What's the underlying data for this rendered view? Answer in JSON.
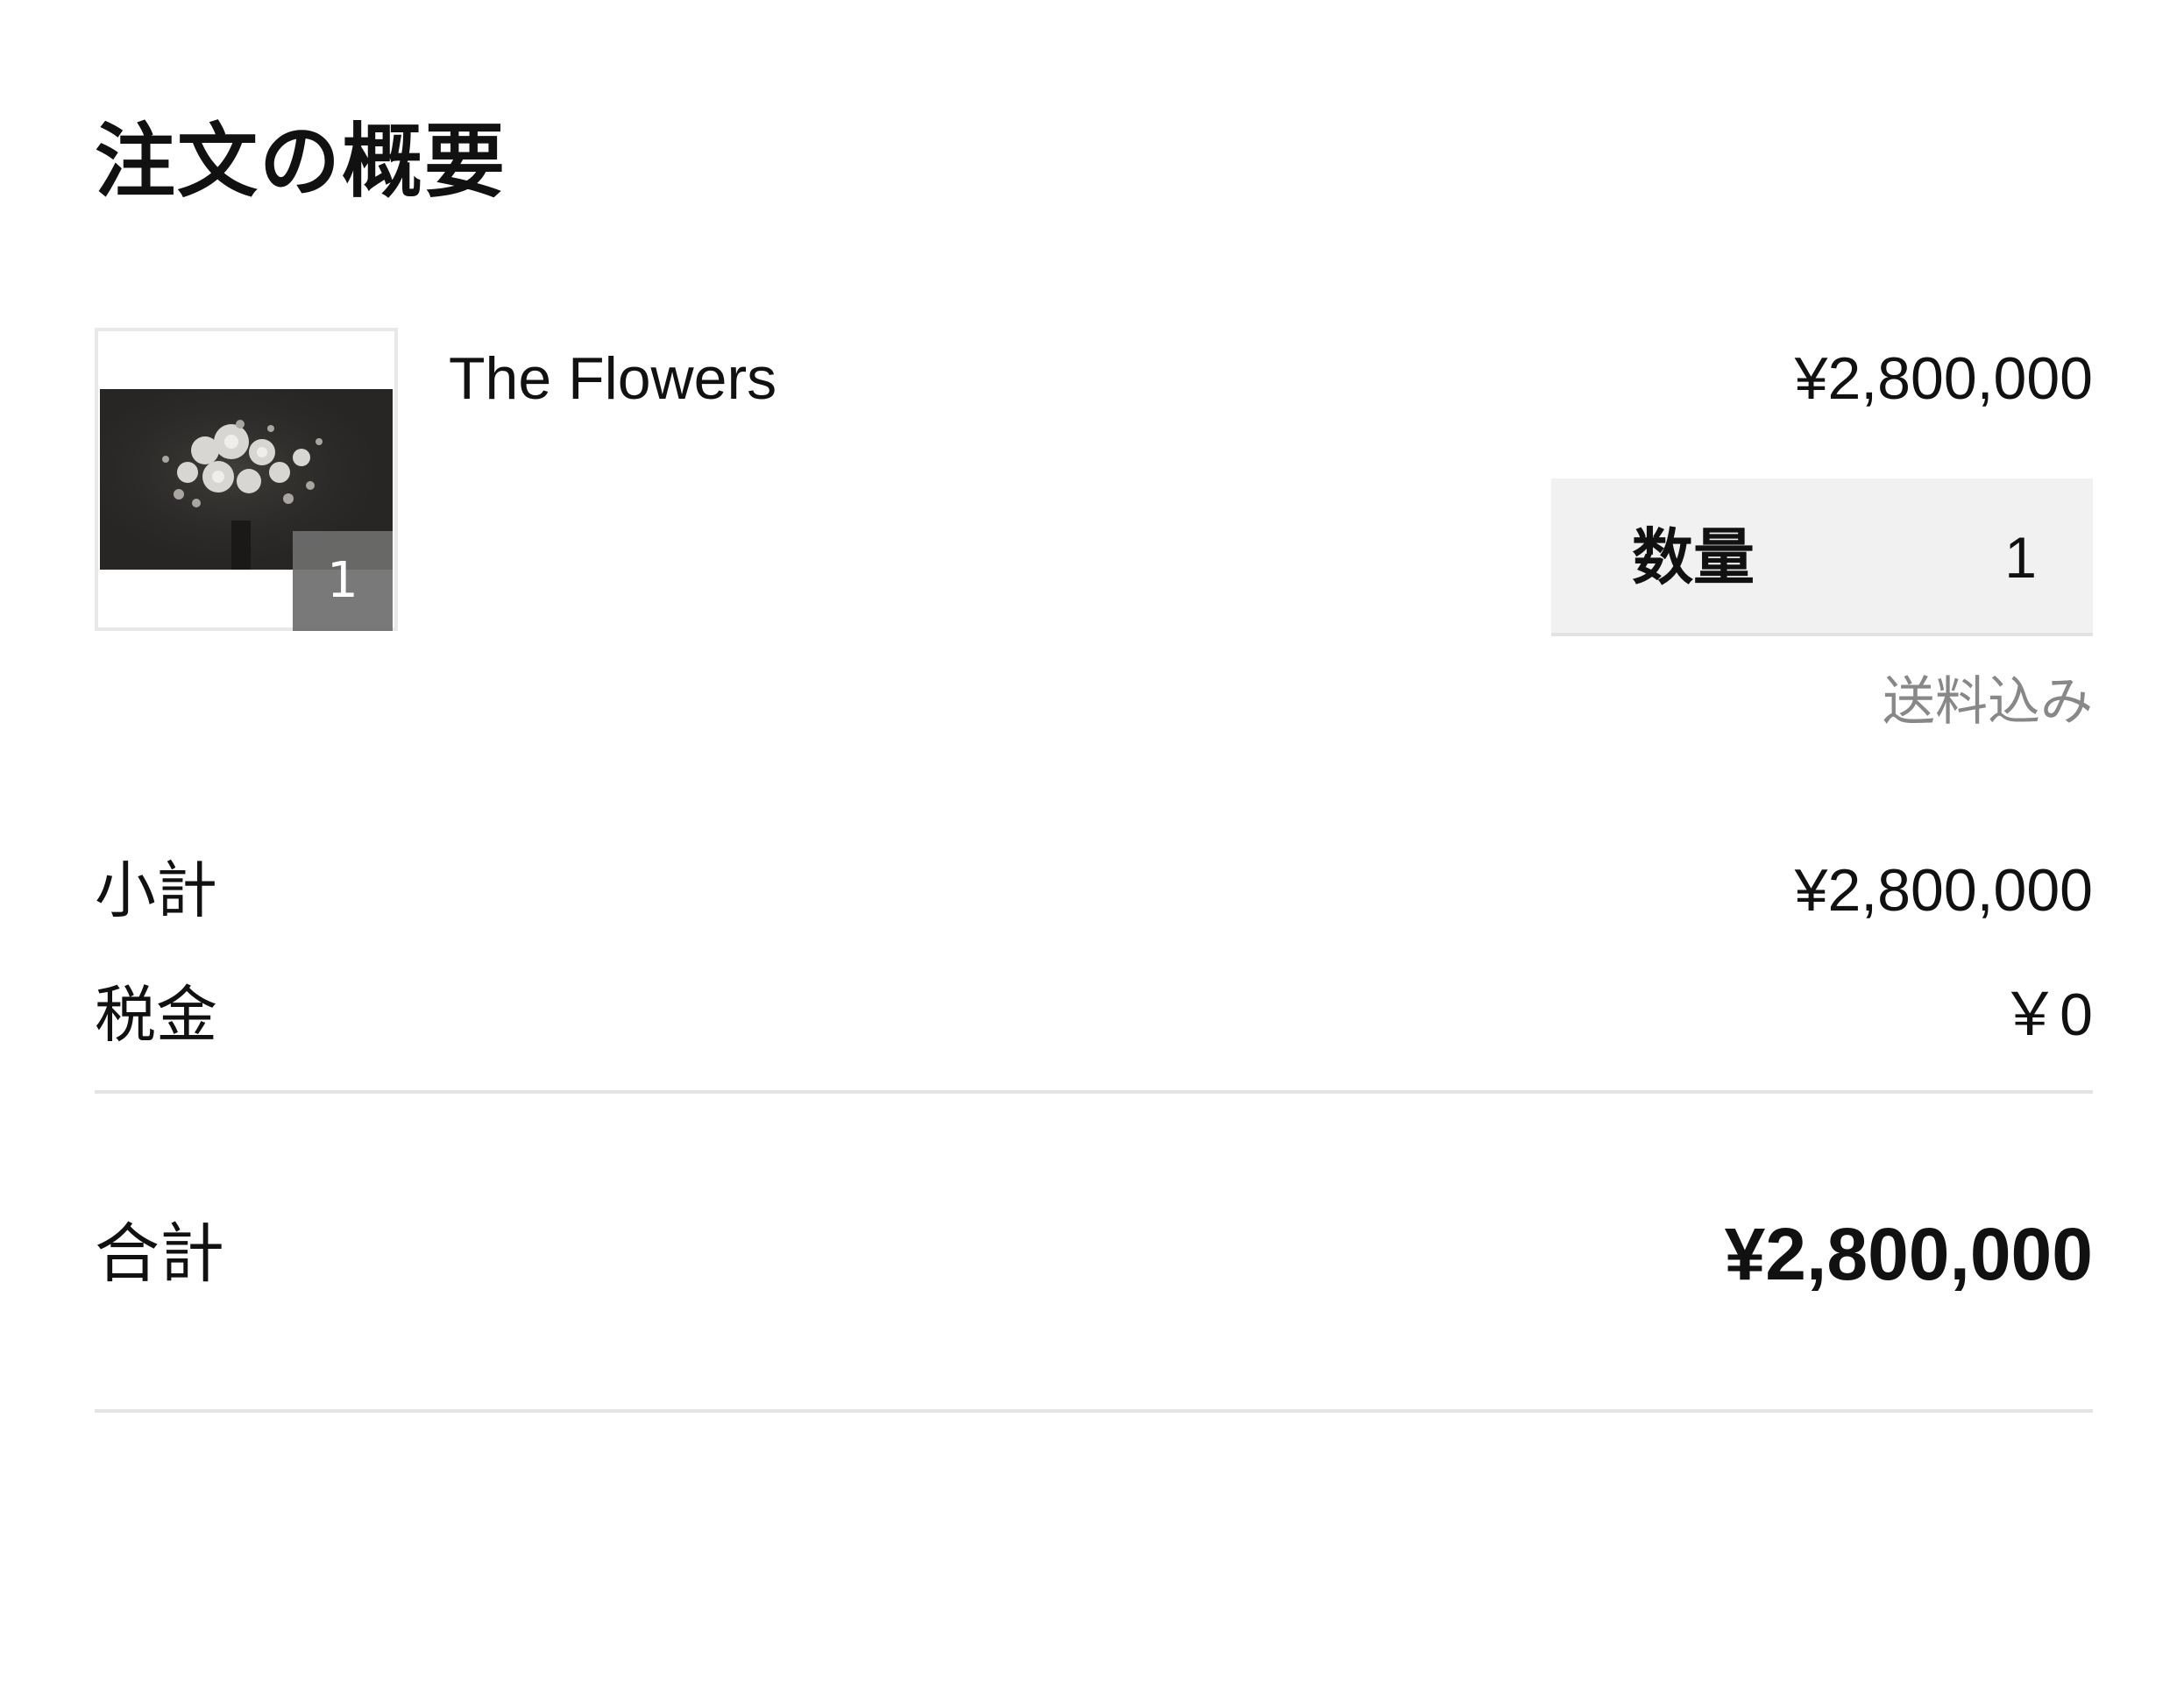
{
  "summary": {
    "title": "注文の概要"
  },
  "item": {
    "name": "The Flowers",
    "price": "¥2,800,000",
    "badge_count": "1",
    "thumbnail_icon": "flower-bouquet-photo",
    "quantity_label": "数量",
    "quantity_value": "1",
    "shipping_note": "送料込み"
  },
  "totals": {
    "subtotal_label": "小計",
    "subtotal_value": "¥2,800,000",
    "tax_label": "税金",
    "tax_value": "￥0",
    "total_label": "合計",
    "total_value": "¥2,800,000"
  },
  "colors": {
    "text": "#111111",
    "muted": "#888888",
    "quantity_bg": "#f1f1f1",
    "divider": "#e4e4e4",
    "badge_bg": "#6e6e6e"
  }
}
